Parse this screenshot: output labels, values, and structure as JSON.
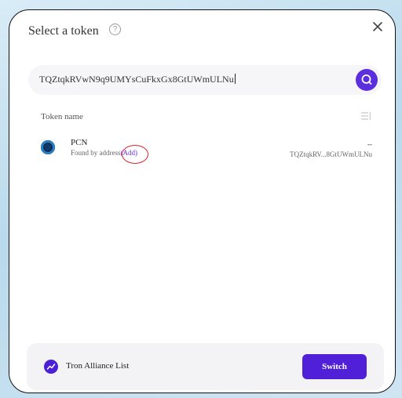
{
  "modal": {
    "title": "Select a token",
    "help_icon": "?"
  },
  "search": {
    "value": "TQZtqkRVwN9q9UMYsCuFkxGx8GtUWmULNu",
    "button_icon": "search-icon"
  },
  "list": {
    "column_header": "Token name",
    "tokens": [
      {
        "symbol": "PCN",
        "found_by": "Found by address",
        "add_label": "(Add)",
        "balance": "--",
        "address": "TQZtqkRV...8GtUWmULNu"
      }
    ]
  },
  "footer": {
    "label": "Tron Alliance List",
    "switch_label": "Switch"
  },
  "colors": {
    "accent": "#5b2ee0",
    "annotation_ring": "#d9262f"
  }
}
